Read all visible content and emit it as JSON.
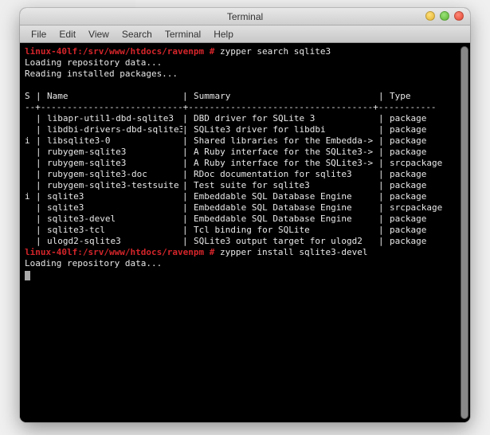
{
  "window_title": "Terminal",
  "menubar": {
    "file": "File",
    "edit": "Edit",
    "view": "View",
    "search": "Search",
    "terminal": "Terminal",
    "help": "Help"
  },
  "prompt1_host": "linux-40lf:/srv/www/htdocs/ravenpm #",
  "command1": "zypper search sqlite3",
  "loading1": "Loading repository data...",
  "reading": "Reading installed packages...",
  "columns": {
    "s": "S",
    "name": "Name",
    "summary": "Summary",
    "type": "Type"
  },
  "rows": [
    {
      "s": " ",
      "name": "libapr-util1-dbd-sqlite3",
      "summary": "DBD driver for SQLite 3",
      "type": "package"
    },
    {
      "s": " ",
      "name": "libdbi-drivers-dbd-sqlite3",
      "summary": "SQLite3 driver for libdbi",
      "type": "package"
    },
    {
      "s": "i",
      "name": "libsqlite3-0",
      "summary": "Shared libraries for the Embedda->",
      "type": "package"
    },
    {
      "s": " ",
      "name": "rubygem-sqlite3",
      "summary": "A Ruby interface for the SQLite3->",
      "type": "package"
    },
    {
      "s": " ",
      "name": "rubygem-sqlite3",
      "summary": "A Ruby interface for the SQLite3->",
      "type": "srcpackage"
    },
    {
      "s": " ",
      "name": "rubygem-sqlite3-doc",
      "summary": "RDoc documentation for sqlite3",
      "type": "package"
    },
    {
      "s": " ",
      "name": "rubygem-sqlite3-testsuite",
      "summary": "Test suite for sqlite3",
      "type": "package"
    },
    {
      "s": "i",
      "name": "sqlite3",
      "summary": "Embeddable SQL Database Engine",
      "type": "package"
    },
    {
      "s": " ",
      "name": "sqlite3",
      "summary": "Embeddable SQL Database Engine",
      "type": "srcpackage"
    },
    {
      "s": " ",
      "name": "sqlite3-devel",
      "summary": "Embeddable SQL Database Engine",
      "type": "package"
    },
    {
      "s": " ",
      "name": "sqlite3-tcl",
      "summary": "Tcl binding for SQLite",
      "type": "package"
    },
    {
      "s": " ",
      "name": "ulogd2-sqlite3",
      "summary": "SQLite3 output target for ulogd2",
      "type": "package"
    }
  ],
  "prompt2_host": "linux-40lf:/srv/www/htdocs/ravenpm #",
  "command2": "zypper install sqlite3-devel",
  "loading2": "Loading repository data..."
}
